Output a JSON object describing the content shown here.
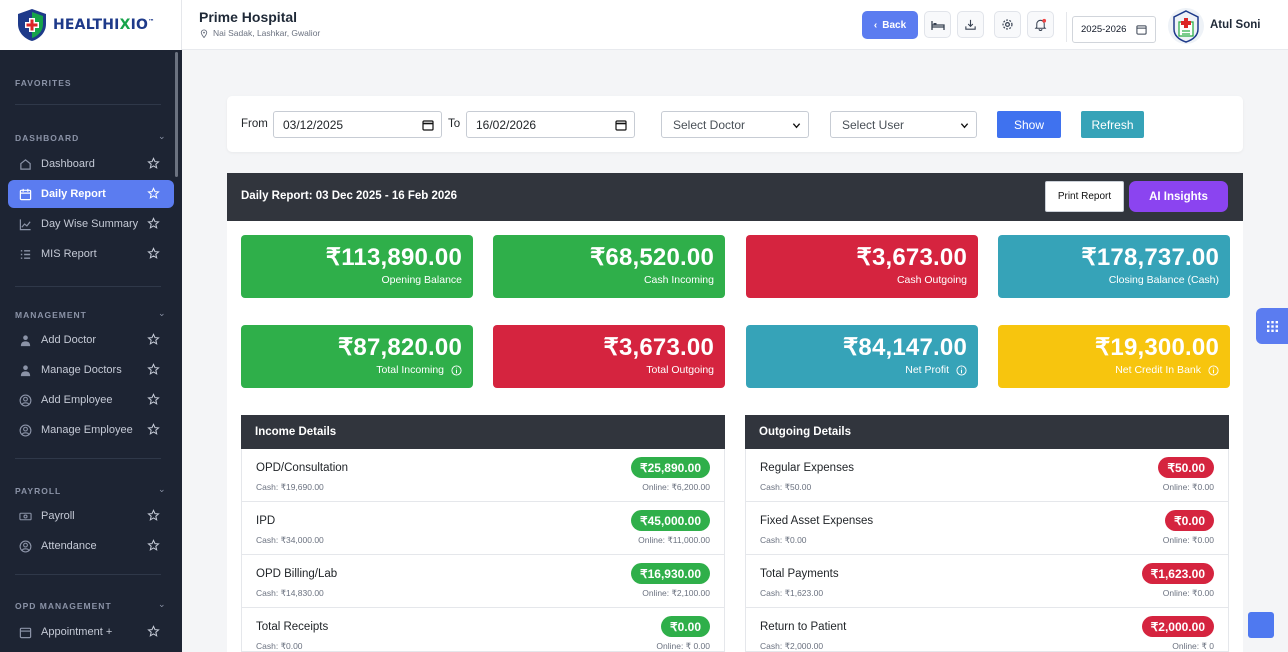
{
  "brand": {
    "logo_text_a": "HEALTHI",
    "logo_text_b": "X",
    "logo_text_c": "IO",
    "logo_tm": "™"
  },
  "sidebar": {
    "sections": {
      "favorites": "FAVORITES",
      "dashboard": "DASHBOARD",
      "management": "MANAGEMENT",
      "payroll": "PAYROLL",
      "opd": "OPD MANAGEMENT"
    },
    "items": [
      {
        "label": "Dashboard",
        "icon": "home-icon"
      },
      {
        "label": "Daily Report",
        "icon": "calendar-icon",
        "active": true
      },
      {
        "label": "Day Wise Summary",
        "icon": "chart-line-icon"
      },
      {
        "label": "MIS Report",
        "icon": "list-icon"
      },
      {
        "label": "Add Doctor",
        "icon": "doctor-icon"
      },
      {
        "label": "Manage Doctors",
        "icon": "doctor-icon"
      },
      {
        "label": "Add Employee",
        "icon": "user-circle-icon"
      },
      {
        "label": "Manage Employee",
        "icon": "user-circle-icon"
      },
      {
        "label": "Payroll",
        "icon": "money-icon"
      },
      {
        "label": "Attendance",
        "icon": "user-circle-icon"
      },
      {
        "label": "Appointment +",
        "icon": "calendar-icon"
      }
    ]
  },
  "header": {
    "hospital_name": "Prime Hospital",
    "hospital_address": "Nai Sadak, Lashkar, Gwalior",
    "back_label": "Back",
    "financial_year": "2025-2026",
    "user_name": "Atul Soni"
  },
  "filters": {
    "from_label": "From",
    "from_date": "03/12/2025",
    "to_label": "To",
    "to_date": "16/02/2026",
    "doctor_select": "Select Doctor",
    "user_select": "Select User",
    "show_label": "Show",
    "refresh_label": "Refresh"
  },
  "report": {
    "title": "Daily Report: 03 Dec 2025 - 16 Feb 2026",
    "print_label": "Print Report",
    "ai_label": "AI Insights",
    "stats_row1": [
      {
        "amount": "₹113,890.00",
        "label": "Opening Balance",
        "color": "#2faf4a"
      },
      {
        "amount": "₹68,520.00",
        "label": "Cash Incoming",
        "color": "#2faf4a"
      },
      {
        "amount": "₹3,673.00",
        "label": "Cash Outgoing",
        "color": "#d5243f"
      },
      {
        "amount": "₹178,737.00",
        "label": "Closing Balance (Cash)",
        "color": "#36a3b8"
      }
    ],
    "stats_row2": [
      {
        "amount": "₹87,820.00",
        "label": "Total Incoming",
        "color": "#2faf4a"
      },
      {
        "amount": "₹3,673.00",
        "label": "Total Outgoing",
        "color": "#d5243f"
      },
      {
        "amount": "₹84,147.00",
        "label": "Net Profit",
        "color": "#36a3b8"
      },
      {
        "amount": "₹19,300.00",
        "label": "Net Credit In Bank",
        "color": "#f7c50e"
      }
    ],
    "income": {
      "title": "Income Details",
      "rows": [
        {
          "name": "OPD/Consultation",
          "amount": "₹25,890.00",
          "cash": "Cash: ₹19,690.00",
          "online": "Online: ₹6,200.00"
        },
        {
          "name": "IPD",
          "amount": "₹45,000.00",
          "cash": "Cash: ₹34,000.00",
          "online": "Online: ₹11,000.00"
        },
        {
          "name": "OPD Billing/Lab",
          "amount": "₹16,930.00",
          "cash": "Cash: ₹14,830.00",
          "online": "Online: ₹2,100.00"
        },
        {
          "name": "Total Receipts",
          "amount": "₹0.00",
          "cash": "Cash: ₹0.00",
          "online": "Online: ₹ 0.00"
        }
      ]
    },
    "outgoing": {
      "title": "Outgoing Details",
      "rows": [
        {
          "name": "Regular Expenses",
          "amount": "₹50.00",
          "cash": "Cash: ₹50.00",
          "online": "Online: ₹0.00"
        },
        {
          "name": "Fixed Asset Expenses",
          "amount": "₹0.00",
          "cash": "Cash: ₹0.00",
          "online": "Online: ₹0.00"
        },
        {
          "name": "Total Payments",
          "amount": "₹1,623.00",
          "cash": "Cash: ₹1,623.00",
          "online": "Online: ₹0.00"
        },
        {
          "name": "Return to Patient",
          "amount": "₹2,000.00",
          "cash": "Cash: ₹2,000.00",
          "online": "Online: ₹ 0"
        }
      ]
    }
  }
}
